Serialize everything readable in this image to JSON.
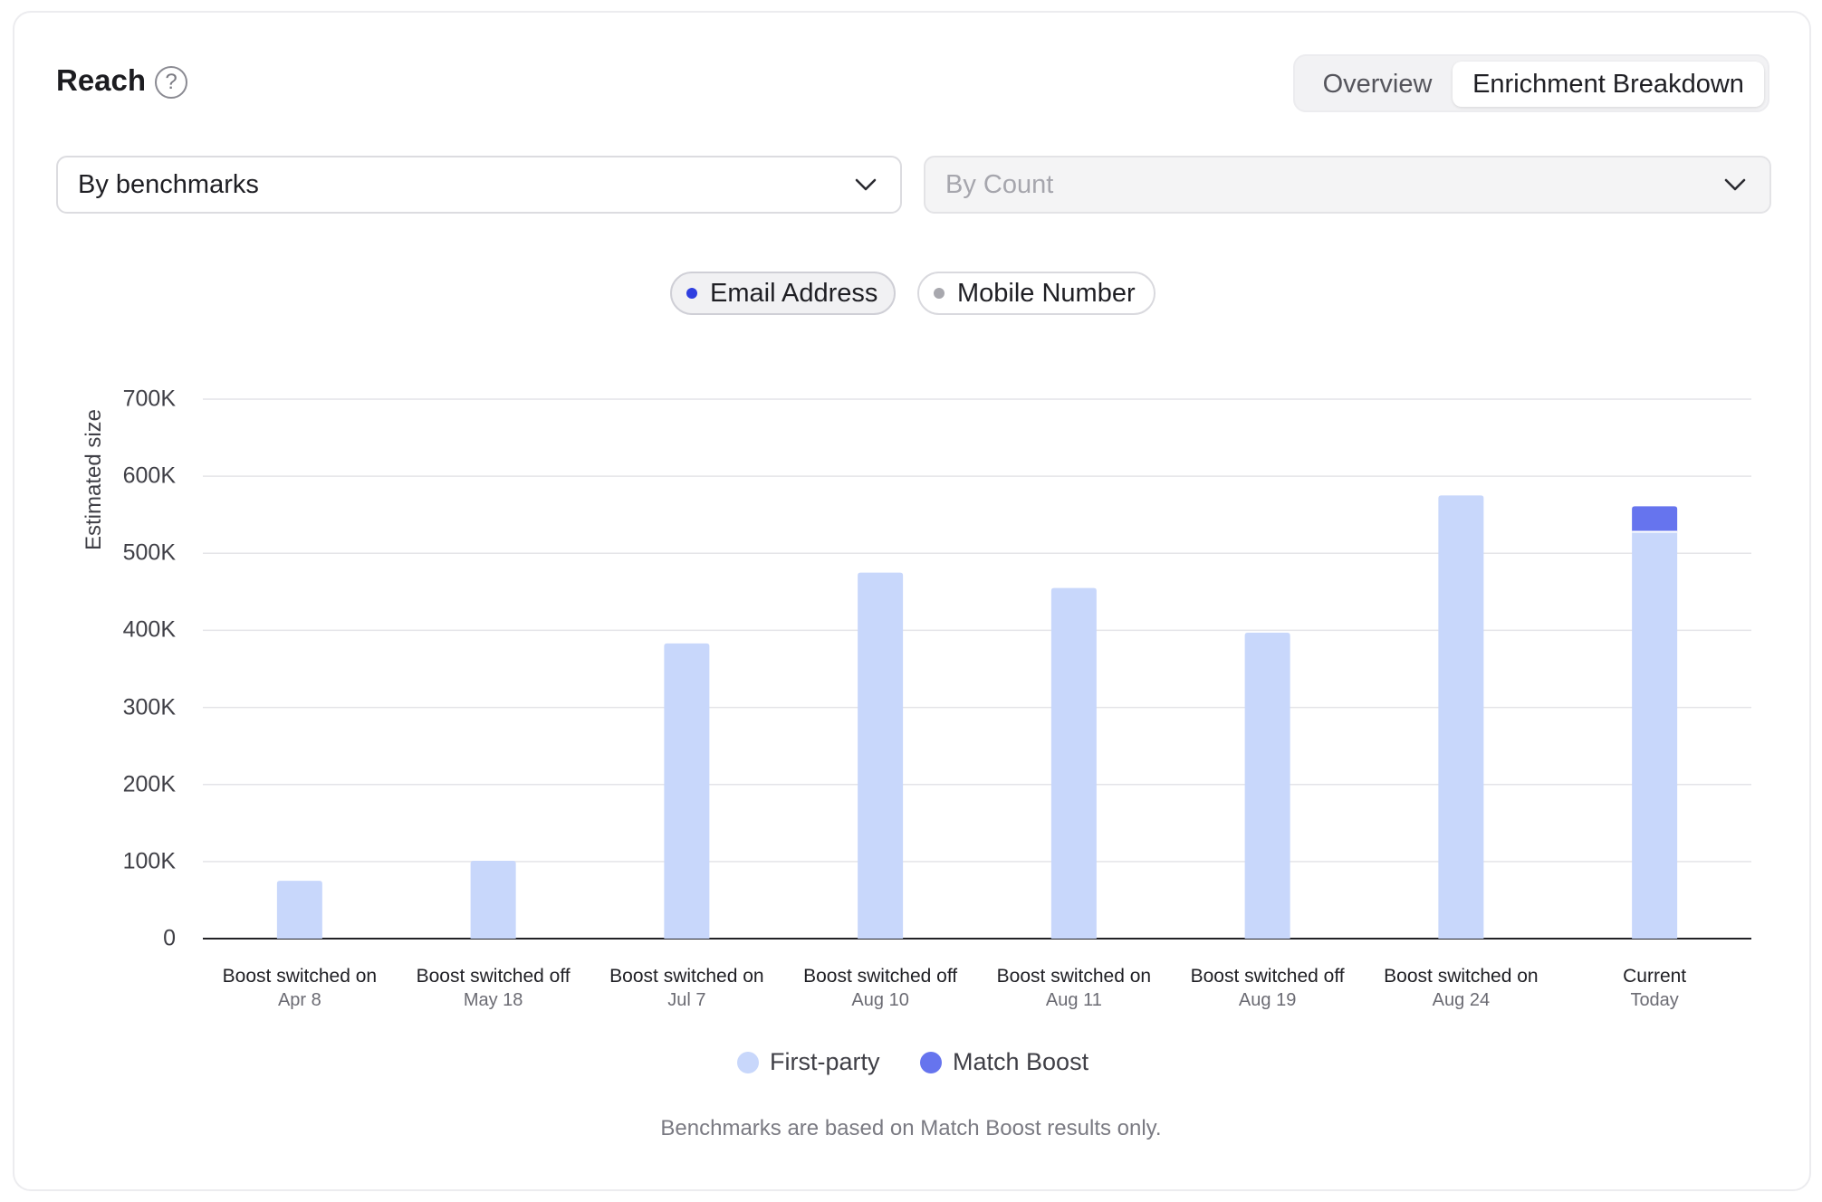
{
  "header": {
    "title": "Reach",
    "help_icon": "question-circle-icon",
    "view_tabs": [
      {
        "label": "Overview",
        "active": false
      },
      {
        "label": "Enrichment Breakdown",
        "active": true
      }
    ]
  },
  "filters": {
    "group_by": {
      "value": "By benchmarks",
      "icon": "chevron-down-icon"
    },
    "metric": {
      "value": "By Count",
      "disabled": true,
      "icon": "chevron-down-icon"
    }
  },
  "identifier_toggles": [
    {
      "label": "Email Address",
      "active": true,
      "dot_color": "#2f3fe0"
    },
    {
      "label": "Mobile Number",
      "active": false,
      "dot_color": "#a8a8ae"
    }
  ],
  "chart_data": {
    "type": "bar",
    "stacked": true,
    "ylabel": "Estimated size",
    "ylim": [
      0,
      700000
    ],
    "yticks": [
      {
        "value": 0,
        "label": "0"
      },
      {
        "value": 100000,
        "label": "100K"
      },
      {
        "value": 200000,
        "label": "200K"
      },
      {
        "value": 300000,
        "label": "300K"
      },
      {
        "value": 400000,
        "label": "400K"
      },
      {
        "value": 500000,
        "label": "500K"
      },
      {
        "value": 600000,
        "label": "600K"
      },
      {
        "value": 700000,
        "label": "700K"
      }
    ],
    "grid": true,
    "categories": [
      {
        "label": "Boost switched on",
        "sublabel": "Apr 8"
      },
      {
        "label": "Boost switched off",
        "sublabel": "May 18"
      },
      {
        "label": "Boost switched on",
        "sublabel": "Jul 7"
      },
      {
        "label": "Boost switched off",
        "sublabel": "Aug 10"
      },
      {
        "label": "Boost switched on",
        "sublabel": "Aug 11"
      },
      {
        "label": "Boost switched off",
        "sublabel": "Aug 19"
      },
      {
        "label": "Boost switched on",
        "sublabel": "Aug 24"
      },
      {
        "label": "Current",
        "sublabel": "Today"
      }
    ],
    "series": [
      {
        "name": "First-party",
        "color": "#c8d7fb",
        "values": [
          75000,
          101000,
          383000,
          475000,
          455000,
          397000,
          575000,
          528000
        ]
      },
      {
        "name": "Match Boost",
        "color": "#6674ee",
        "values": [
          0,
          0,
          0,
          0,
          0,
          0,
          0,
          33000
        ]
      }
    ],
    "legend_position": "bottom"
  },
  "footnote": "Benchmarks are based on Match Boost results only."
}
